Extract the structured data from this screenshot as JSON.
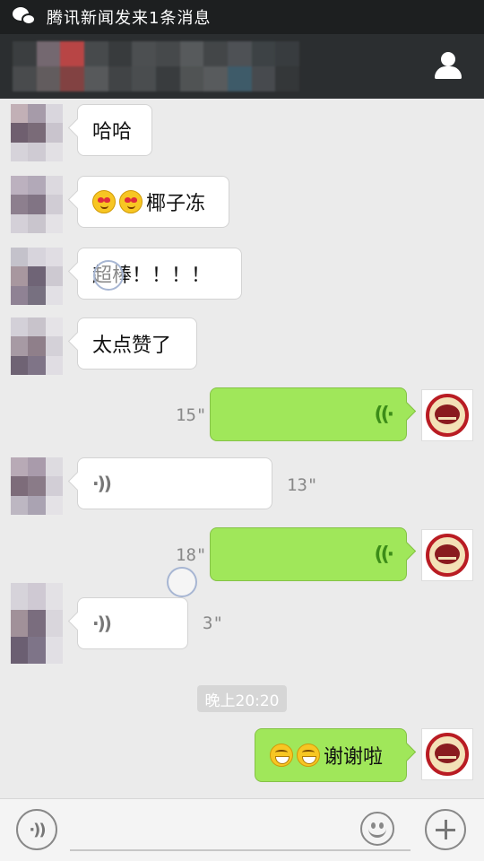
{
  "status_bar": {
    "notification": "腾讯新闻发来1条消息",
    "icon": "wechat-icon"
  },
  "header": {
    "title": "",
    "profile_icon": "person-icon"
  },
  "messages": [
    {
      "side": "left",
      "type": "text",
      "text": "哈哈"
    },
    {
      "side": "left",
      "type": "text",
      "emojis": [
        "heart-eyes-emoji",
        "heart-eyes-emoji"
      ],
      "text": "椰子冻"
    },
    {
      "side": "left",
      "type": "text",
      "text": "超棒！！！！"
    },
    {
      "side": "left",
      "type": "text",
      "text": "太点赞了"
    },
    {
      "side": "right",
      "type": "voice",
      "duration": "15\""
    },
    {
      "side": "left",
      "type": "voice",
      "duration": "13\""
    },
    {
      "side": "right",
      "type": "voice",
      "duration": "18\""
    },
    {
      "side": "left",
      "type": "voice",
      "duration": "3\""
    },
    {
      "side": "right",
      "type": "text",
      "emojis": [
        "grin-emoji",
        "grin-emoji"
      ],
      "text": "谢谢啦"
    }
  ],
  "timestamp": "晚上20:20",
  "voice_glyph_left": "·))",
  "voice_glyph_right": "((·",
  "input_bar": {
    "voice_glyph": "·))",
    "placeholder": ""
  },
  "colors": {
    "sent_bubble": "#a0e75a",
    "received_bubble": "#ffffff",
    "background": "#ebebeb",
    "title_bar": "#2b2e30"
  }
}
